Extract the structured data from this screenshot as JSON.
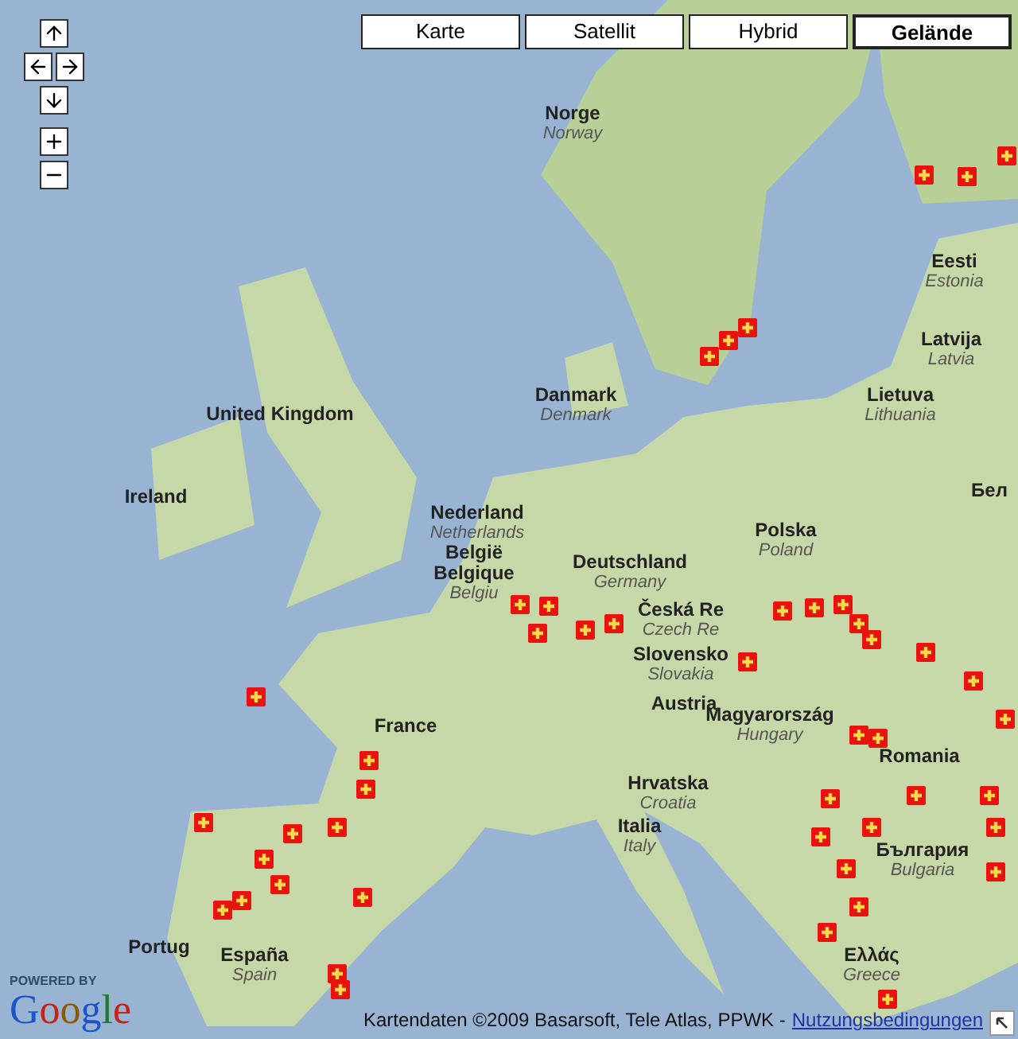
{
  "map_types": [
    {
      "label": "Karte",
      "selected": false
    },
    {
      "label": "Satellit",
      "selected": false
    },
    {
      "label": "Hybrid",
      "selected": false
    },
    {
      "label": "Gelände",
      "selected": true
    }
  ],
  "labels": [
    {
      "name": "Norge",
      "english": "Norway"
    },
    {
      "name": "Eesti",
      "english": "Estonia"
    },
    {
      "name": "Latvija",
      "english": "Latvia"
    },
    {
      "name": "United Kingdom"
    },
    {
      "name": "Danmark",
      "english": "Denmark"
    },
    {
      "name": "Lietuva",
      "english": "Lithuania"
    },
    {
      "name": "Ireland"
    },
    {
      "name": "Бел"
    },
    {
      "name": "Nederland",
      "english": "Netherlands"
    },
    {
      "name": "Polska",
      "english": "Poland"
    },
    {
      "name": "België",
      "alt_name": "Belgique",
      "english": "Belgiu"
    },
    {
      "name": "Deutschland",
      "english": "Germany"
    },
    {
      "name": "Česká Re",
      "english": "Czech Re"
    },
    {
      "name": "Slovensko",
      "english": "Slovakia"
    },
    {
      "name": "Austria"
    },
    {
      "name": "France"
    },
    {
      "name": "Magyarország",
      "english": "Hungary"
    },
    {
      "name": "Romania"
    },
    {
      "name": "Hrvatska",
      "english": "Croatia"
    },
    {
      "name": "Italia",
      "english": "Italy"
    },
    {
      "name": "България",
      "english": "Bulgaria"
    },
    {
      "name": "Portug"
    },
    {
      "name": "España",
      "english": "Spain"
    },
    {
      "name": "Ελλάς",
      "english": "Greece"
    }
  ],
  "logo": {
    "caption": "POWERED BY",
    "name": "Google"
  },
  "attribution": {
    "text": "Kartendaten ©2009 Basarsoft, Tele Atlas, PPWK -",
    "link": "Nutzungsbedingungen"
  }
}
